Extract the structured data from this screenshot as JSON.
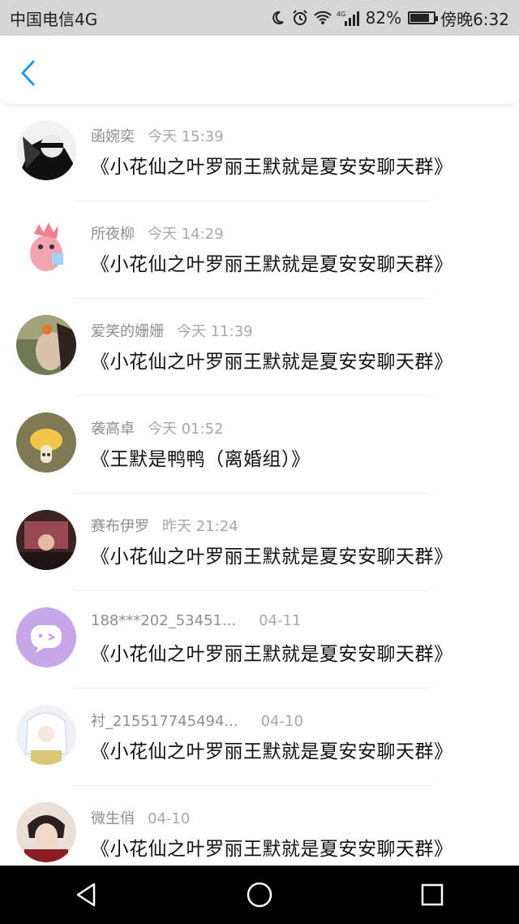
{
  "status_bar": {
    "carrier": "中国电信4G",
    "battery_percent": "82%",
    "battery_level": 0.82,
    "time": "傍晚6:32",
    "net_label": "4G",
    "icons": [
      "moon-icon",
      "alarm-icon",
      "wifi-icon",
      "signal-icon",
      "battery-icon"
    ]
  },
  "header": {
    "back_icon": "chevron-left-icon",
    "accent_color": "#2196f3"
  },
  "items": [
    {
      "name": "函婉奕",
      "time": "今天 15:39",
      "group": "《小花仙之叶罗丽王默就是夏安安聊天群》"
    },
    {
      "name": "所夜柳",
      "time": "今天 14:29",
      "group": "《小花仙之叶罗丽王默就是夏安安聊天群》"
    },
    {
      "name": "爱笑的姗姗",
      "time": "今天 11:39",
      "group": "《小花仙之叶罗丽王默就是夏安安聊天群》"
    },
    {
      "name": "袭高卓",
      "time": "今天 01:52",
      "group": "《王默是鸭鸭（离婚组）》"
    },
    {
      "name": "赛布伊罗",
      "time": "昨天 21:24",
      "group": "《小花仙之叶罗丽王默就是夏安安聊天群》"
    },
    {
      "name": "188***202_53451...",
      "time": "04-11",
      "group": "《小花仙之叶罗丽王默就是夏安安聊天群》"
    },
    {
      "name": "衬_215517745494...",
      "time": "04-10",
      "group": "《小花仙之叶罗丽王默就是夏安安聊天群》"
    },
    {
      "name": "微生俏",
      "time": "04-10",
      "group": "《小花仙之叶罗丽王默就是夏安安聊天群》"
    }
  ],
  "nav": {
    "icons": [
      "back-triangle-icon",
      "home-circle-icon",
      "recents-square-icon"
    ]
  }
}
